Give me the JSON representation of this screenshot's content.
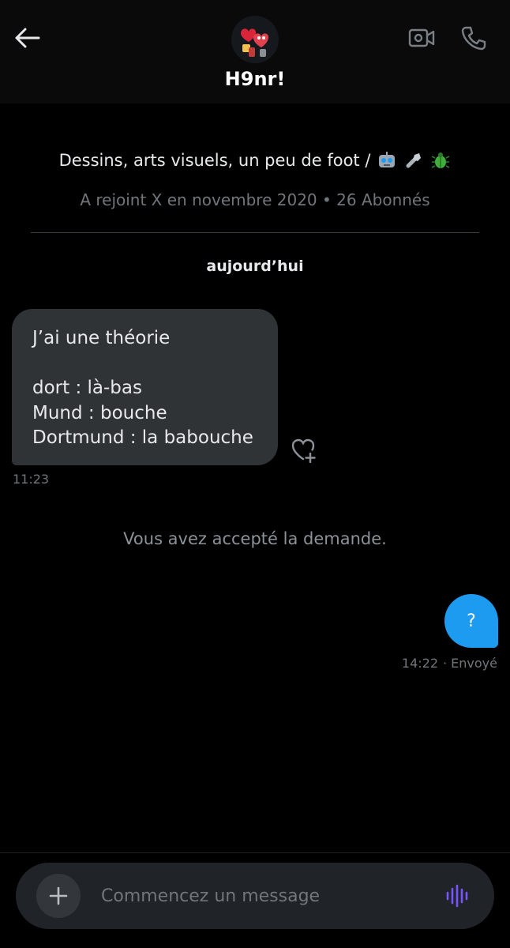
{
  "header": {
    "username": "H9nr!",
    "avatar_icon": "heart-characters-avatar",
    "back_icon": "arrow-left-icon",
    "video_icon": "video-camera-icon",
    "call_icon": "phone-icon"
  },
  "profile": {
    "bio": "Dessins, arts visuels, un peu de foot /",
    "bio_emojis": [
      "robot-emoji",
      "bolt-emoji",
      "beetle-emoji"
    ],
    "meta": "A rejoint X en novembre 2020 • 26 Abonnés"
  },
  "conversation": {
    "date_label": "aujourd’hui",
    "incoming": {
      "lines": [
        "J’ai une théorie",
        "",
        "dort : là-bas",
        "Mund : bouche",
        "Dortmund : la babouche"
      ],
      "time": "11:23"
    },
    "system_message": "Vous avez accepté la demande.",
    "outgoing": {
      "text": "?",
      "time": "14:22",
      "status": "· Envoyé"
    }
  },
  "composer": {
    "placeholder": "Commencez un message",
    "plus_icon": "plus-icon",
    "voice_icon": "voice-wave-icon"
  },
  "colors": {
    "background": "#000000",
    "incoming_bubble": "#2f3336",
    "outgoing_bubble": "#1d9bf0",
    "muted_text": "#71767b",
    "voice_accent": "#7856ff"
  }
}
